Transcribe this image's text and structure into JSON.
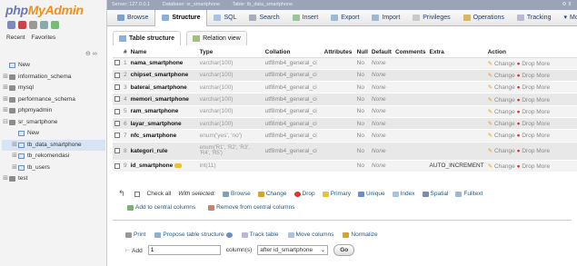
{
  "logo": {
    "php": "php",
    "myadmin": "MyAdmin"
  },
  "nav": {
    "tabs": [
      "Recent",
      "Favorites"
    ],
    "collapse_icon": "link-collapse-icon",
    "tree": [
      {
        "label": "New",
        "level": 0
      },
      {
        "label": "information_schema",
        "level": 0
      },
      {
        "label": "mysql",
        "level": 0
      },
      {
        "label": "performance_schema",
        "level": 0
      },
      {
        "label": "phpmyadmin",
        "level": 0
      },
      {
        "label": "sr_smartphone",
        "level": 0
      },
      {
        "label": "New",
        "level": 1
      },
      {
        "label": "tb_data_smartphone",
        "level": 1
      },
      {
        "label": "tb_rekomendasi",
        "level": 1
      },
      {
        "label": "tb_users",
        "level": 1
      },
      {
        "label": "test",
        "level": 0
      }
    ]
  },
  "topbar": {
    "breadcrumbs": [
      "Server: 127.0.0.1",
      "Database: sr_smartphone",
      "Table: tb_data_smartphone"
    ]
  },
  "menu": {
    "tabs": [
      "Browse",
      "Structure",
      "SQL",
      "Search",
      "Insert",
      "Export",
      "Import",
      "Privileges",
      "Operations",
      "Tracking",
      "More"
    ]
  },
  "subtabs": [
    "Table structure",
    "Relation view"
  ],
  "columns": {
    "headers": [
      "#",
      "Name",
      "Type",
      "Collation",
      "Attributes",
      "Null",
      "Default",
      "Comments",
      "Extra",
      "Action"
    ]
  },
  "rows": [
    {
      "num": "1",
      "name": "nama_smartphone",
      "type": "varchar(100)",
      "collation": "utf8mb4_general_ci",
      "null": "No",
      "default": "None",
      "extra": ""
    },
    {
      "num": "2",
      "name": "chipset_smartphone",
      "type": "varchar(100)",
      "collation": "utf8mb4_general_ci",
      "null": "No",
      "default": "None",
      "extra": ""
    },
    {
      "num": "3",
      "name": "baterai_smartphone",
      "type": "varchar(100)",
      "collation": "utf8mb4_general_ci",
      "null": "No",
      "default": "None",
      "extra": ""
    },
    {
      "num": "4",
      "name": "memori_smartphone",
      "type": "varchar(100)",
      "collation": "utf8mb4_general_ci",
      "null": "No",
      "default": "None",
      "extra": ""
    },
    {
      "num": "5",
      "name": "ram_smartphone",
      "type": "varchar(100)",
      "collation": "utf8mb4_general_ci",
      "null": "No",
      "default": "None",
      "extra": ""
    },
    {
      "num": "6",
      "name": "layar_smartphone",
      "type": "varchar(100)",
      "collation": "utf8mb4_general_ci",
      "null": "No",
      "default": "None",
      "extra": ""
    },
    {
      "num": "7",
      "name": "nfc_smartphone",
      "type": "enum('yes', 'no')",
      "collation": "utf8mb4_general_ci",
      "null": "No",
      "default": "None",
      "extra": ""
    },
    {
      "num": "8",
      "name": "kategori_rule",
      "type": "enum('R1', 'R2', 'R3', 'R4', 'R5')",
      "collation": "utf8mb4_general_ci",
      "null": "No",
      "default": "None",
      "extra": ""
    },
    {
      "num": "9",
      "name": "id_smartphone",
      "type": "int(11)",
      "collation": "",
      "null": "No",
      "default": "None",
      "extra": "AUTO_INCREMENT"
    }
  ],
  "row_actions": {
    "change": "Change",
    "drop": "Drop",
    "more": "More"
  },
  "bulk": {
    "check_all": "Check all",
    "with_selected": "With selected:",
    "actions": [
      "Browse",
      "Change",
      "Drop",
      "Primary",
      "Unique",
      "Index",
      "Spatial",
      "Fulltext"
    ],
    "add_central": "Add to central columns",
    "remove_central": "Remove from central columns"
  },
  "footer": {
    "links": [
      "Print",
      "Propose table structure",
      "Track table",
      "Move columns",
      "Normalize"
    ],
    "add_label": "Add",
    "add_value": "1",
    "columns_label": "column(s)",
    "position_value": "after id_smartphone",
    "go_label": "Go"
  },
  "colors": {
    "accent": "#235a81",
    "logo_php": "#6c78af",
    "logo_myadmin": "#f29111",
    "drop": "#dd3333"
  }
}
